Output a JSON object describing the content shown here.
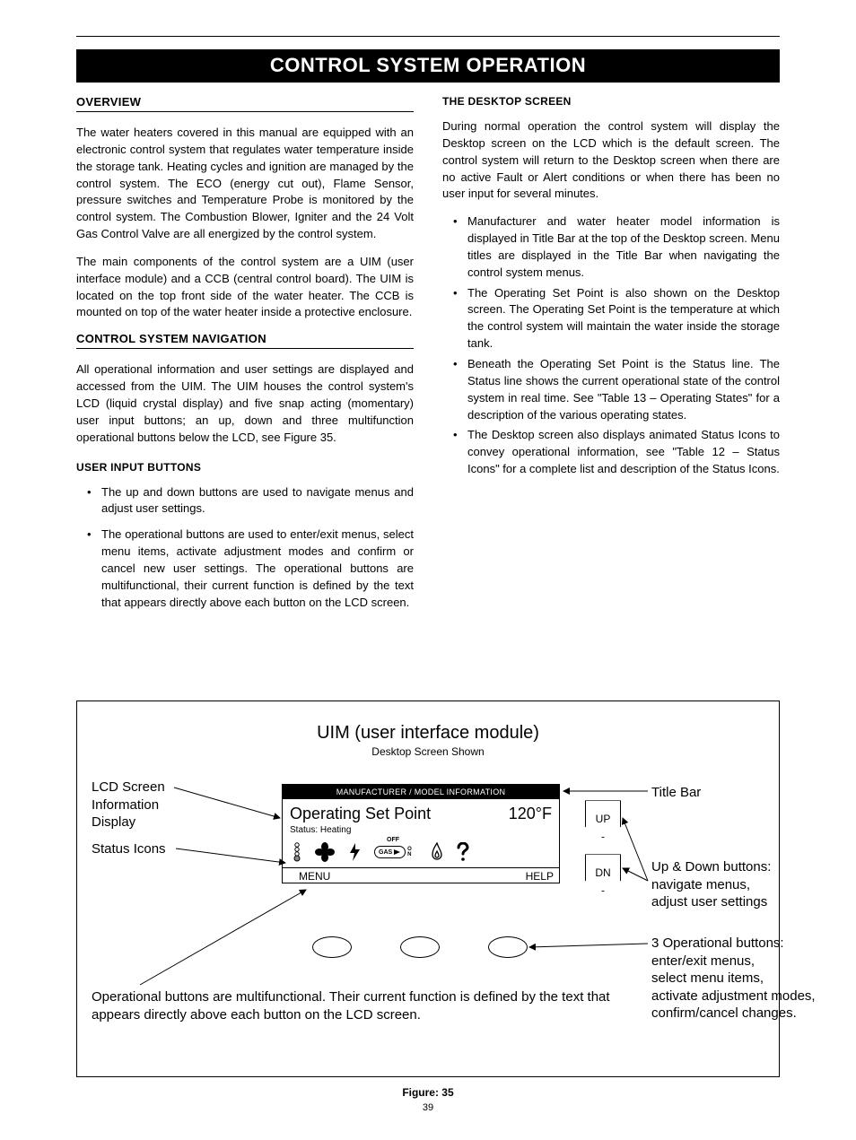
{
  "banner": "CONTROL SYSTEM OPERATION",
  "left": {
    "overview_head": "OVERVIEW",
    "overview_p1": "The water heaters covered in this manual are equipped with an electronic control system that regulates water temperature inside the storage tank. Heating cycles and ignition are managed by the control system. The ECO (energy cut out), Flame Sensor, pressure switches and Temperature Probe is monitored by the control system. The Combustion Blower, Igniter and the 24 Volt Gas Control Valve are all energized by the control system.",
    "overview_p2": "The main components of the control system are a UIM (user interface module) and a CCB (central control board). The UIM is located on the top front side of the water heater. The CCB is mounted on top of the water heater inside a protective enclosure.",
    "nav_head": "CONTROL SYSTEM NAVIGATION",
    "nav_p1": "All operational information and user settings are displayed and accessed from the UIM. The UIM houses the control system's LCD (liquid crystal display) and five snap acting (momentary) user input buttons; an up, down and three multifunction operational buttons below the LCD, see Figure 35.",
    "uib_head": "USER INPUT BUTTONS",
    "uib_b1": "The up and down buttons are used to navigate menus and adjust user settings.",
    "uib_b2": "The operational buttons are used to enter/exit menus, select menu items, activate adjustment modes and confirm or cancel new user settings. The operational buttons are multifunctional, their current function is defined by the text that appears directly above each button on the LCD screen."
  },
  "right": {
    "ds_head": "THE DESKTOP SCREEN",
    "ds_p1": "During normal operation the control system will display the Desktop screen on the LCD which is the default screen. The control system will return to the Desktop screen when there are no active Fault or Alert conditions or when there has been no user input for several minutes.",
    "ds_b1": "Manufacturer and water heater model information is displayed in Title Bar at the top of the Desktop screen. Menu titles are displayed in the Title Bar when navigating the control system menus.",
    "ds_b2": "The Operating Set Point is also shown on the Desktop screen. The Operating Set Point is the temperature at which the control system will maintain the water inside the storage tank.",
    "ds_b3": "Beneath the Operating Set Point is the Status line. The Status line shows the current operational state of the control system in real time. See \"Table 13 – Operating States\" for a description of the various operating states.",
    "ds_b4": "The Desktop screen also displays animated Status Icons to convey operational information, see \"Table 12 – Status Icons\" for a complete list and description of the Status Icons."
  },
  "figure": {
    "title": "UIM (user interface module)",
    "sub": "Desktop Screen Shown",
    "titlebar": "MANUFACTURER / MODEL INFORMATION",
    "setpoint_label": "Operating Set Point",
    "setpoint_value": "120°F",
    "status_line": "Status: Heating",
    "gas_off": "OFF",
    "gas": "GAS",
    "gas_on": "O\nN",
    "menu": "MENU",
    "help": "HELP",
    "up": "UP",
    "dn": "DN",
    "label_lcd": "LCD Screen\nInformation\nDisplay",
    "label_icons": "Status Icons",
    "label_title": "Title Bar",
    "label_ud": "Up & Down buttons:\nnavigate menus,\nadjust user settings",
    "label_op": "3 Operational buttons:\nenter/exit menus,\nselect menu items,\nactivate adjustment modes,\nconfirm/cancel changes.",
    "label_opnote": "Operational buttons are multifunctional. Their current function is defined by the text that appears directly above each button on the LCD screen.",
    "caption": "Figure: 35",
    "page": "39"
  }
}
